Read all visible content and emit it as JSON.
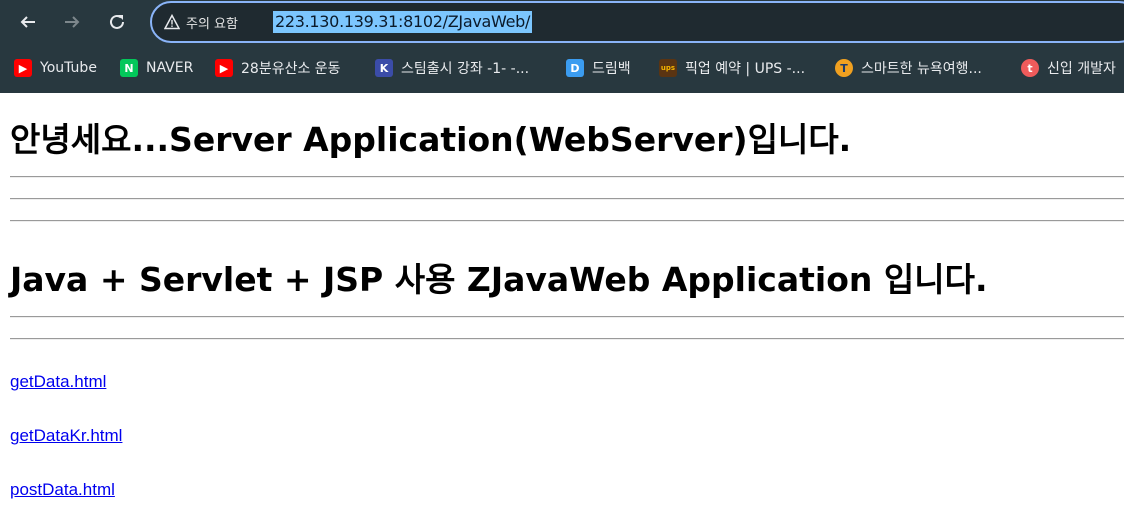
{
  "browser": {
    "security_label": "주의 요함",
    "url": "223.130.139.31:8102/ZJavaWeb/",
    "accent": "#8ab4f8",
    "bookmarks": [
      {
        "label": "YouTube",
        "icon": "youtube-icon"
      },
      {
        "label": "NAVER",
        "icon": "naver-icon"
      },
      {
        "label": "28분유산소 운동",
        "icon": "youtube-icon"
      },
      {
        "label": "스팀출시 강좌 -1- -...",
        "icon": "steam-course-icon"
      },
      {
        "label": "드림백",
        "icon": "dreamback-icon"
      },
      {
        "label": "픽업 예약 | UPS -...",
        "icon": "ups-icon"
      },
      {
        "label": "스마트한 뉴욕여행...",
        "icon": "travel-icon"
      },
      {
        "label": "신입 개발자",
        "icon": "developer-icon"
      }
    ]
  },
  "page": {
    "heading1": "안녕세요...Server Application(WebServer)입니다.",
    "heading2": "Java + Servlet + JSP 사용 ZJavaWeb Application 입니다.",
    "links": [
      "getData.html",
      "getDataKr.html",
      "postData.html"
    ]
  }
}
